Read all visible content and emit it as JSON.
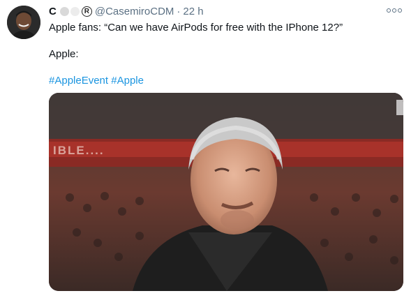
{
  "tweet": {
    "author": {
      "display_name": "C",
      "handle": "@CasemiroCDM",
      "registered_mark": "R",
      "avatar_icon": "user-avatar"
    },
    "separator": "·",
    "timestamp": "22 h",
    "more_icon": "more-options-icon",
    "text_line_1": "Apple fans: “Can we have AirPods for free with the IPhone 12?”",
    "text_line_2": "Apple:",
    "hashtags": [
      "#AppleEvent",
      "#Apple"
    ],
    "media": {
      "type": "photo",
      "banner_text": "IBLE...."
    },
    "colors": {
      "link": "#1b95e0",
      "secondary_text": "#5b7083"
    }
  }
}
